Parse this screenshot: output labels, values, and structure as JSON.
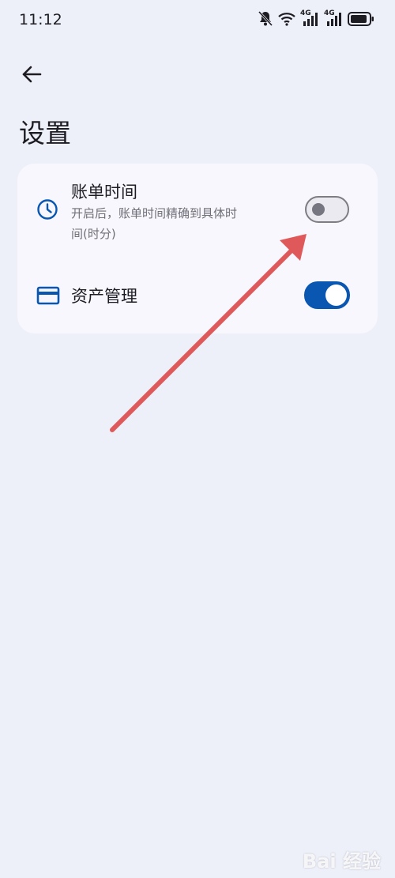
{
  "status_bar": {
    "time": "11:12",
    "icons": [
      "bell-muted-icon",
      "wifi-icon",
      "signal-4g-icon",
      "signal-4g-icon",
      "battery-icon"
    ],
    "network_label_1": "4G",
    "network_label_2": "4G"
  },
  "header": {
    "back_icon": "arrow-left-icon",
    "title": "设置"
  },
  "settings": {
    "items": [
      {
        "icon": "clock-icon",
        "title": "账单时间",
        "description": "开启后，账单时间精确到具体时间(时分)",
        "enabled": false
      },
      {
        "icon": "credit-card-icon",
        "title": "资产管理",
        "enabled": true
      }
    ]
  },
  "colors": {
    "accent": "#0a57b2",
    "background": "#eef0f9",
    "card": "#f8f7fd",
    "annotation_arrow": "#e0595a"
  },
  "watermark": "Bai 经验"
}
